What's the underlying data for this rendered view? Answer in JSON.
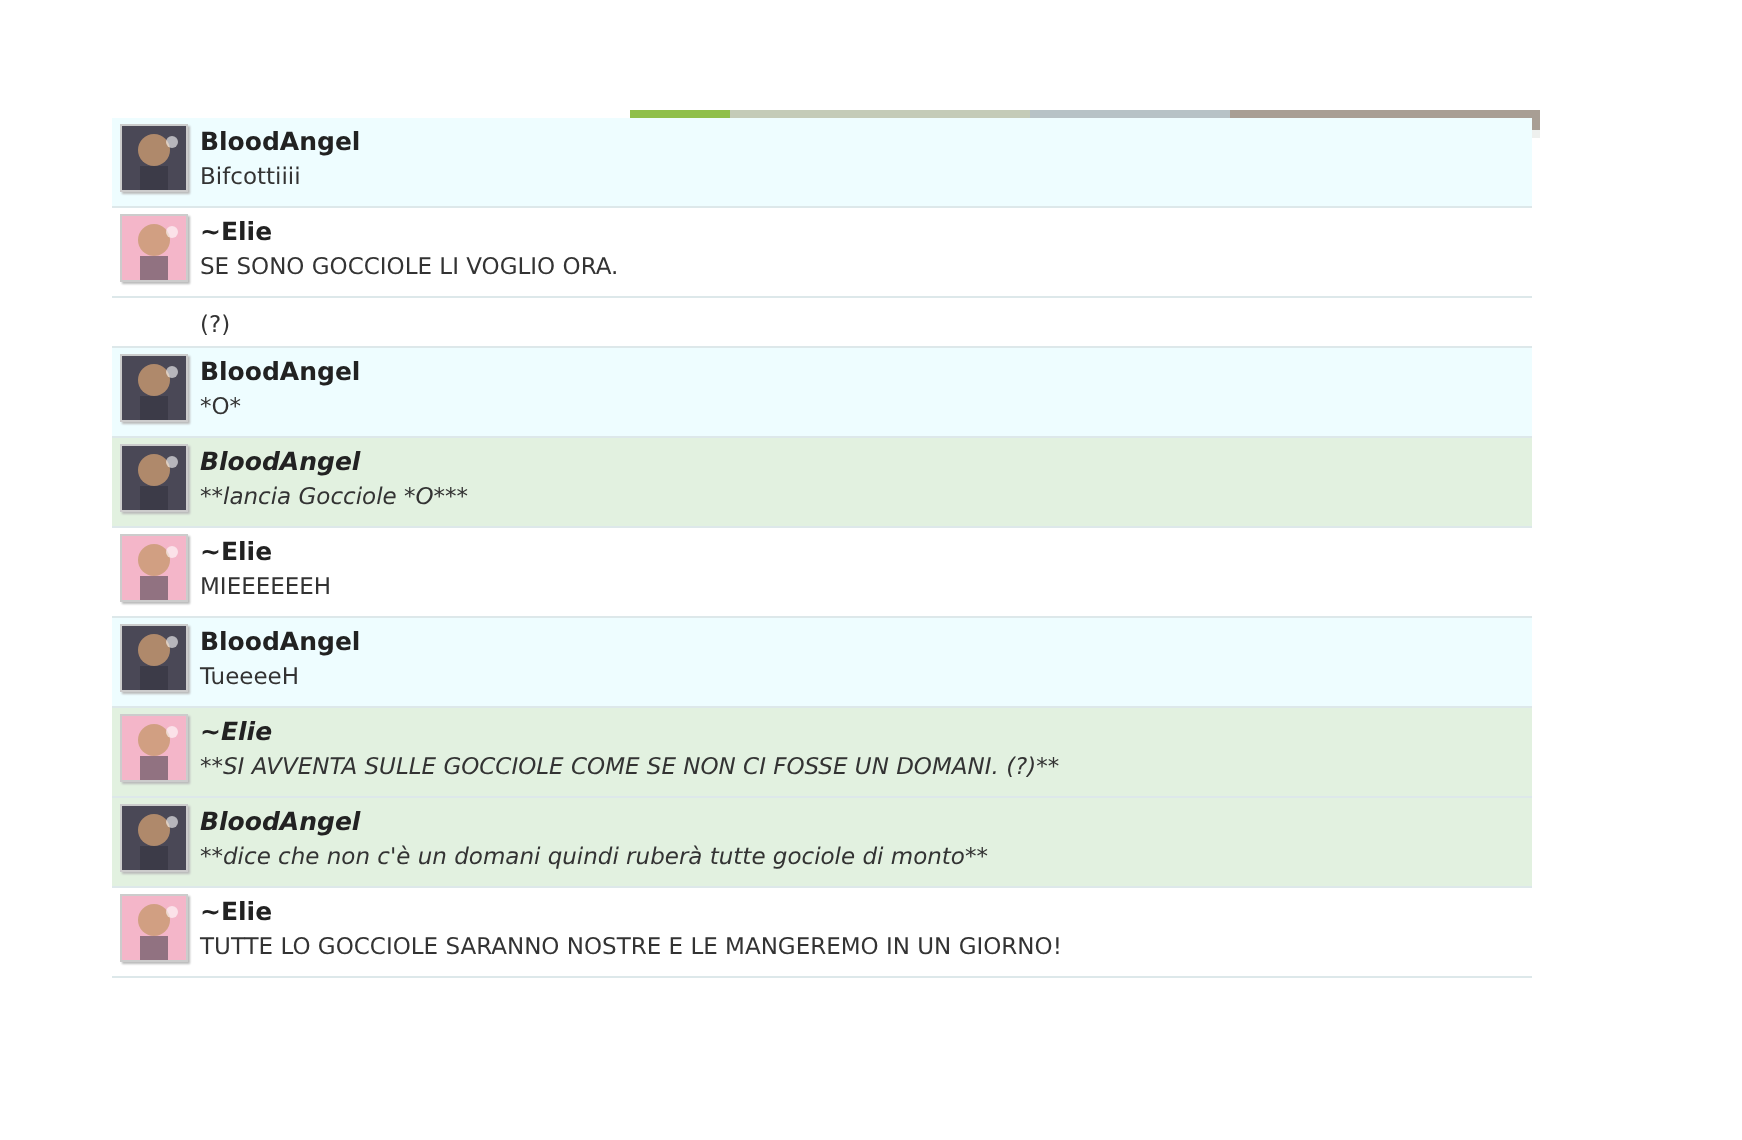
{
  "messages": [
    {
      "kind": "own",
      "avatar": {
        "color": "#4a4856"
      },
      "user": "BloodAngel",
      "lines": [
        "Bifcottiiii"
      ]
    },
    {
      "kind": "other",
      "avatar": {
        "color": "#f4b6c9"
      },
      "user": "~Elie",
      "lines": [
        "SE SONO GOCCIOLE LI VOGLIO ORA."
      ]
    },
    {
      "kind": "continuation",
      "lines": [
        "(?)"
      ]
    },
    {
      "kind": "own",
      "avatar": {
        "color": "#4a4856"
      },
      "user": "BloodAngel",
      "lines": [
        "*O*"
      ]
    },
    {
      "kind": "action",
      "avatar": {
        "color": "#4a4856"
      },
      "user": "BloodAngel",
      "lines": [
        "**lancia Gocciole *O***"
      ]
    },
    {
      "kind": "other",
      "avatar": {
        "color": "#f4b6c9"
      },
      "user": "~Elie",
      "lines": [
        "MIEEEEEEH"
      ]
    },
    {
      "kind": "own",
      "avatar": {
        "color": "#4a4856"
      },
      "user": "BloodAngel",
      "lines": [
        "TueeeeH"
      ]
    },
    {
      "kind": "action",
      "avatar": {
        "color": "#f4b6c9"
      },
      "user": "~Elie",
      "lines": [
        "**SI AVVENTA SULLE GOCCIOLE COME SE NON CI FOSSE UN DOMANI. (?)**"
      ]
    },
    {
      "kind": "action",
      "avatar": {
        "color": "#4a4856"
      },
      "user": "BloodAngel",
      "lines": [
        "**dice che non c'è un domani quindi ruberà tutte gociole di monto**"
      ]
    },
    {
      "kind": "other",
      "avatar": {
        "color": "#f4b6c9"
      },
      "user": "~Elie",
      "lines": [
        "TUTTE LO GOCCIOLE SARANNO NOSTRE E LE MANGEREMO IN UN GIORNO!"
      ]
    }
  ]
}
